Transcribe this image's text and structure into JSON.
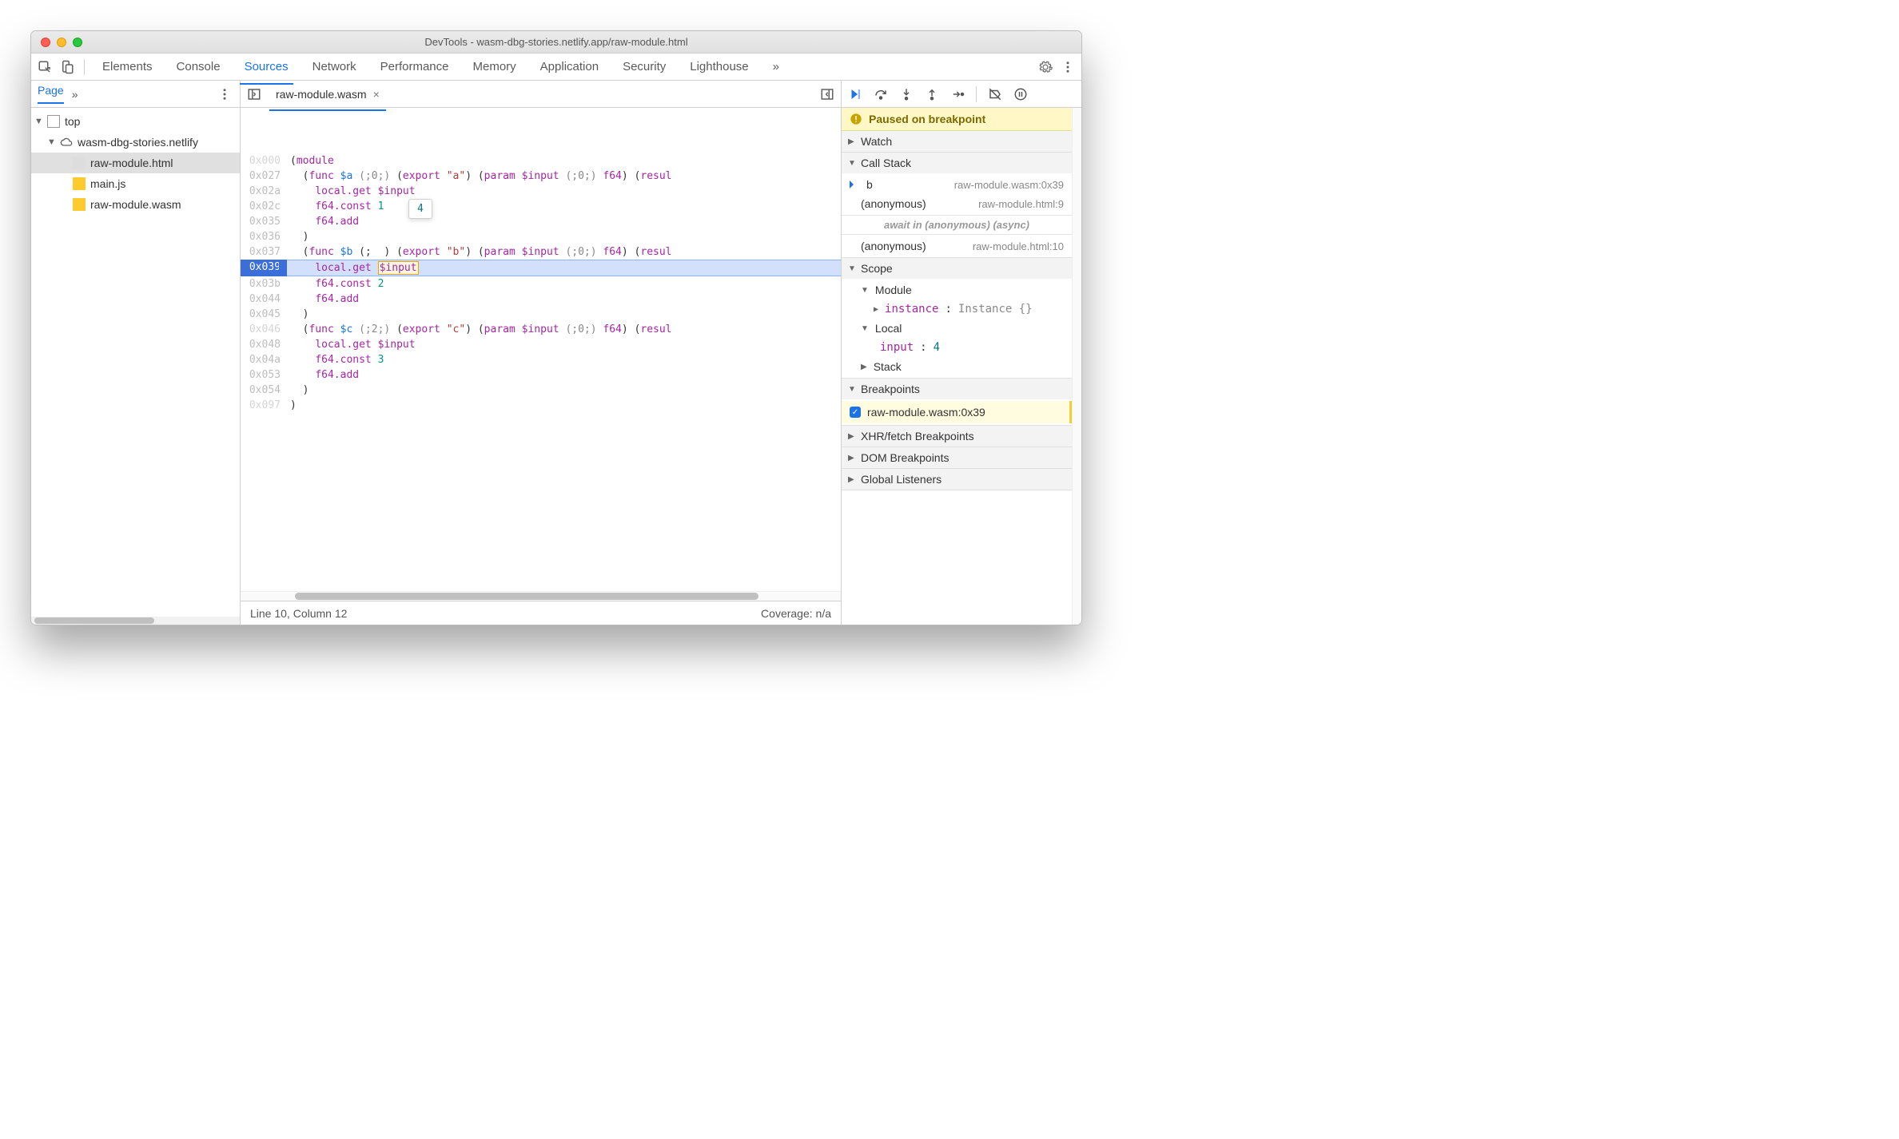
{
  "window": {
    "title": "DevTools - wasm-dbg-stories.netlify.app/raw-module.html"
  },
  "tabs": {
    "items": [
      "Elements",
      "Console",
      "Sources",
      "Network",
      "Performance",
      "Memory",
      "Application",
      "Security",
      "Lighthouse"
    ],
    "active": "Sources",
    "overflow": "»"
  },
  "navigator": {
    "page_tab": "Page",
    "overflow": "»",
    "tree": {
      "top": "top",
      "origin": "wasm-dbg-stories.netlify",
      "files": [
        {
          "name": "raw-module.html",
          "kind": "html",
          "selected": true
        },
        {
          "name": "main.js",
          "kind": "js"
        },
        {
          "name": "raw-module.wasm",
          "kind": "wasm"
        }
      ]
    }
  },
  "source": {
    "open_file": "raw-module.wasm",
    "tooltip_value": "4",
    "status_left": "Line 10, Column 12",
    "status_right": "Coverage: n/a",
    "lines": [
      {
        "addr": "0x000",
        "dim": true,
        "html": "(<span class='kw'>module</span>"
      },
      {
        "addr": "0x027",
        "html": "  (<span class='kw'>func</span> <span class='fn'>$a</span> <span class='cm'>(;0;)</span> (<span class='kw'>export</span> <span class='str'>\"a\"</span>) (<span class='kw'>param</span> <span class='var'>$input</span> <span class='cm'>(;0;)</span> <span class='kw'>f64</span>) (<span class='kw'>resul</span>"
      },
      {
        "addr": "0x02a",
        "html": "    <span class='kw'>local.get</span> <span class='var'>$input</span>"
      },
      {
        "addr": "0x02c",
        "html": "    <span class='kw'>f64.const</span> <span class='num'>1</span>"
      },
      {
        "addr": "0x035",
        "html": "    <span class='kw'>f64.add</span>"
      },
      {
        "addr": "0x036",
        "html": "  )"
      },
      {
        "addr": "0x037",
        "html": "  (<span class='kw'>func</span> <span class='fn'>$b</span> (;&nbsp;&nbsp;) (<span class='kw'>export</span> <span class='str'>\"b\"</span>) (<span class='kw'>param</span> <span class='var'>$input</span> <span class='cm'>(;0;)</span> <span class='kw'>f64</span>) (<span class='kw'>resul</span>"
      },
      {
        "addr": "0x039",
        "current": true,
        "html": "    <span class='kw'>local.get</span> <span class='tok-hilite var'>$input</span>"
      },
      {
        "addr": "0x03b",
        "html": "    <span class='kw'>f64.const</span> <span class='num'>2</span>"
      },
      {
        "addr": "0x044",
        "html": "    <span class='kw'>f64.add</span>"
      },
      {
        "addr": "0x045",
        "html": "  )"
      },
      {
        "addr": "0x046",
        "dim": true,
        "html": "  (<span class='kw'>func</span> <span class='fn'>$c</span> <span class='cm'>(;2;)</span> (<span class='kw'>export</span> <span class='str'>\"c\"</span>) (<span class='kw'>param</span> <span class='var'>$input</span> <span class='cm'>(;0;)</span> <span class='kw'>f64</span>) (<span class='kw'>resul</span>"
      },
      {
        "addr": "0x048",
        "html": "    <span class='kw'>local.get</span> <span class='var'>$input</span>"
      },
      {
        "addr": "0x04a",
        "html": "    <span class='kw'>f64.const</span> <span class='num'>3</span>"
      },
      {
        "addr": "0x053",
        "html": "    <span class='kw'>f64.add</span>"
      },
      {
        "addr": "0x054",
        "html": "  )"
      },
      {
        "addr": "0x097",
        "dim": true,
        "html": ")"
      }
    ]
  },
  "debugger": {
    "banner": "Paused on breakpoint",
    "sections": {
      "watch": "Watch",
      "callstack": "Call Stack",
      "scope": "Scope",
      "breakpoints": "Breakpoints",
      "xhr": "XHR/fetch Breakpoints",
      "dom": "DOM Breakpoints",
      "listeners": "Global Listeners"
    },
    "callstack": [
      {
        "name": "b",
        "loc": "raw-module.wasm:0x39",
        "current": true
      },
      {
        "name": "(anonymous)",
        "loc": "raw-module.html:9"
      },
      {
        "async": "await in (anonymous) (async)"
      },
      {
        "name": "(anonymous)",
        "loc": "raw-module.html:10"
      }
    ],
    "scope": {
      "module": {
        "label": "Module",
        "prop": "instance",
        "val": "Instance {}"
      },
      "local": {
        "label": "Local",
        "prop": "input",
        "val": "4"
      },
      "stack": {
        "label": "Stack"
      }
    },
    "breakpoints": [
      {
        "label": "raw-module.wasm:0x39",
        "checked": true
      }
    ]
  }
}
